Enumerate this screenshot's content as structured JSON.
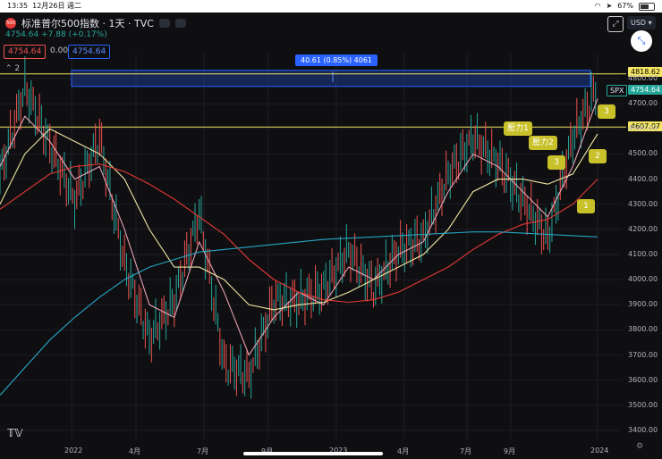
{
  "status": {
    "time": "13:35",
    "date": "12月26日 週二",
    "battery": "67%",
    "battery_level": 0.67
  },
  "header": {
    "badge": "500",
    "title": "标准普尔500指数 · 1天 · TVC"
  },
  "quote": {
    "price": "4754.64",
    "change": "+7.88",
    "change_pct": "(+0.17%)"
  },
  "trade": {
    "bid": "4754.64",
    "spread": "0.00",
    "ask": "4754.64"
  },
  "indicators": {
    "count": "2"
  },
  "toolbar": {
    "currency": "USD"
  },
  "price_tags": {
    "top": "4818.62",
    "spx_label": "SPX",
    "last": "4754.64",
    "lower": "4607.07"
  },
  "measure": {
    "text": "40.61 (0.85%) 4061"
  },
  "notes": {
    "resist1": "壓力1",
    "resist2": "壓力2",
    "n3a": "3",
    "n2": "2",
    "n1": "1",
    "n3b": "3"
  },
  "y_axis": [
    "4800.00",
    "4700.00",
    "4600.00",
    "4500.00",
    "4400.00",
    "4300.00",
    "4200.00",
    "4100.00",
    "4000.00",
    "3900.00",
    "3800.00",
    "3700.00",
    "3600.00",
    "3500.00",
    "3400.00"
  ],
  "x_axis": [
    "2022",
    "4月",
    "7月",
    "9月",
    "2023",
    "4月",
    "7月",
    "9月",
    "2024"
  ],
  "chart_data": {
    "type": "line",
    "title": "",
    "ylim": [
      3400,
      4850
    ],
    "x": [
      "2021-11",
      "2022-01",
      "2022-02",
      "2022-03",
      "2022-04",
      "2022-05",
      "2022-06",
      "2022-07",
      "2022-08",
      "2022-09",
      "2022-10",
      "2022-11",
      "2022-12",
      "2023-01",
      "2023-02",
      "2023-03",
      "2023-04",
      "2023-05",
      "2023-06",
      "2023-07",
      "2023-08",
      "2023-09",
      "2023-10",
      "2023-11",
      "2023-12"
    ],
    "series": [
      {
        "values": [
          4400,
          4750,
          4520,
          4300,
          4550,
          4050,
          3750,
          3900,
          4250,
          3650,
          3600,
          3900,
          3900,
          3950,
          4100,
          3950,
          4100,
          4150,
          4400,
          4550,
          4450,
          4300,
          4150,
          4550,
          4754
        ]
      },
      {
        "values": [
          4450,
          4650,
          4550,
          4400,
          4450,
          4200,
          3900,
          3850,
          4150,
          3950,
          3700,
          3850,
          3950,
          3900,
          4050,
          4000,
          4100,
          4150,
          4350,
          4500,
          4450,
          4350,
          4250,
          4450,
          4720
        ]
      },
      {
        "values": [
          4300,
          4500,
          4600,
          4550,
          4500,
          4400,
          4200,
          4050,
          4050,
          4000,
          3900,
          3880,
          3900,
          3910,
          3950,
          4000,
          4050,
          4100,
          4200,
          4350,
          4400,
          4400,
          4380,
          4420,
          4580
        ]
      },
      {
        "values": [
          4280,
          4350,
          4420,
          4450,
          4460,
          4430,
          4380,
          4320,
          4250,
          4180,
          4080,
          4000,
          3950,
          3920,
          3910,
          3920,
          3950,
          4000,
          4050,
          4120,
          4180,
          4220,
          4240,
          4300,
          4400
        ]
      },
      {
        "values": [
          3540,
          3650,
          3760,
          3850,
          3930,
          4000,
          4050,
          4080,
          4110,
          4120,
          4130,
          4140,
          4150,
          4160,
          4165,
          4170,
          4175,
          4180,
          4185,
          4190,
          4190,
          4185,
          4180,
          4175,
          4170
        ]
      }
    ],
    "colors": [
      "#e06c75",
      "#e8a0b0",
      "#f0e6a0",
      "#e53935",
      "#26a6c6"
    ],
    "horizontal_lines": [
      4818.62,
      4607.07
    ]
  }
}
